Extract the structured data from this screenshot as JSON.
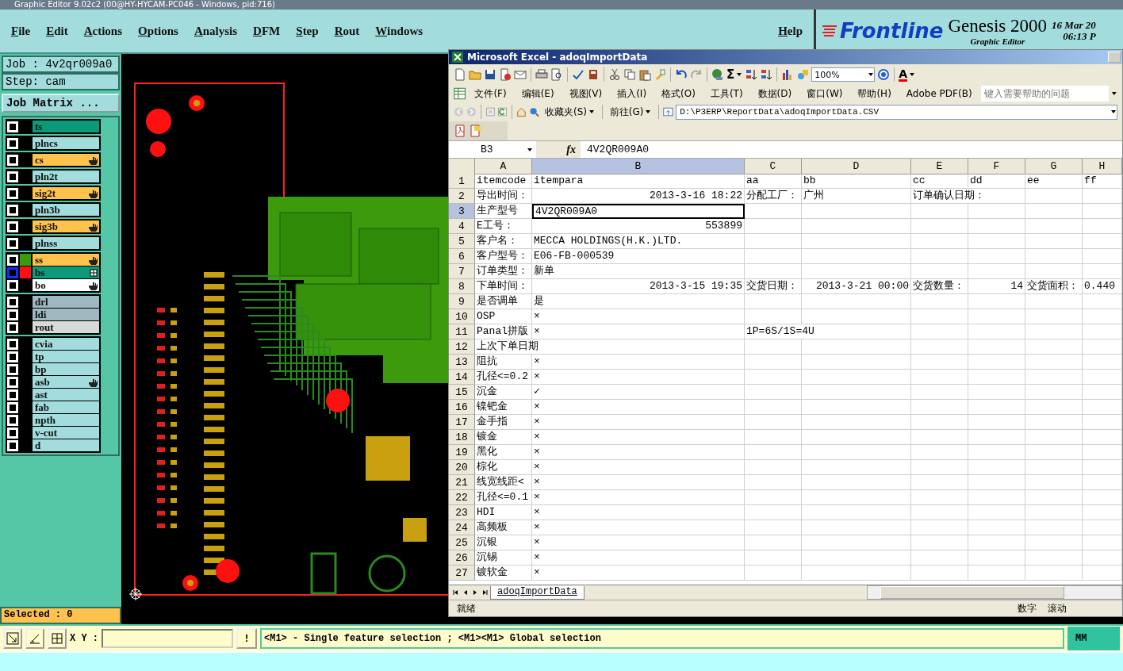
{
  "window": {
    "title": "Graphic Editor 9.02c2 (00@HY-HYCAM-PC046 - Windows, pid:716)"
  },
  "menu": [
    "File",
    "Edit",
    "Actions",
    "Options",
    "Analysis",
    "DFM",
    "Step",
    "Rout",
    "Windows"
  ],
  "help_menu": "Help",
  "brand": {
    "logo": "Frontline",
    "product": "Genesis 2000",
    "subtitle": "Graphic Editor",
    "date": "16 Mar 20",
    "time": "06:13 P"
  },
  "job": {
    "job": "Job : 4v2qr009a0",
    "step": "Step: cam",
    "matrix_button": "Job Matrix ..."
  },
  "layer_groups": [
    {
      "layers": [
        {
          "name": "ts",
          "color": "#0b9b7b",
          "checked": false,
          "affected": false,
          "work": false
        }
      ]
    },
    {
      "layers": [
        {
          "name": "plncs",
          "color": "#a3dcdc",
          "checked": false,
          "affected": false,
          "work": false
        }
      ]
    },
    {
      "layers": [
        {
          "name": "cs",
          "color": "#ffc34d",
          "checked": false,
          "affected": true,
          "work": false
        }
      ]
    },
    {
      "layers": [
        {
          "name": "pln2t",
          "color": "#a3dcdc",
          "checked": false,
          "affected": false,
          "work": false
        }
      ]
    },
    {
      "layers": [
        {
          "name": "sig2t",
          "color": "#ffc34d",
          "checked": false,
          "affected": true,
          "work": false
        }
      ]
    },
    {
      "layers": [
        {
          "name": "pln3b",
          "color": "#a3dcdc",
          "checked": false,
          "affected": false,
          "work": false
        }
      ]
    },
    {
      "layers": [
        {
          "name": "sig3b",
          "color": "#ffc34d",
          "checked": false,
          "affected": true,
          "work": false
        }
      ]
    },
    {
      "layers": [
        {
          "name": "plnss",
          "color": "#a3dcdc",
          "checked": false,
          "affected": false,
          "work": false
        }
      ]
    },
    {
      "layers": [
        {
          "name": "ss",
          "color": "#ffc34d",
          "swatch": {
            "color": "#3c9a0c"
          },
          "checked": false,
          "affected": true,
          "work": false
        },
        {
          "name": "bs",
          "color": "#0b9b7b",
          "swatch": {
            "color": "#ff1010"
          },
          "checked": false,
          "affected": false,
          "work": true
        },
        {
          "name": "bo",
          "color": "#ffffff",
          "checked": false,
          "affected": true,
          "work": false
        }
      ]
    },
    {
      "layers": [
        {
          "name": "drl",
          "color": "#9fb8bf",
          "checked": false,
          "affected": false,
          "work": false
        },
        {
          "name": "ldi",
          "color": "#9fb8bf",
          "checked": false,
          "affected": false,
          "work": false
        },
        {
          "name": "rout",
          "color": "#d9d9d9",
          "checked": false,
          "affected": false,
          "work": false
        }
      ]
    },
    {
      "layers": [
        {
          "name": "cvia",
          "color": "#a3dcdc",
          "checked": false,
          "affected": false,
          "work": false
        },
        {
          "name": "tp",
          "color": "#a3dcdc",
          "checked": false,
          "affected": false,
          "work": false
        },
        {
          "name": "bp",
          "color": "#a3dcdc",
          "checked": false,
          "affected": false,
          "work": false
        },
        {
          "name": "asb",
          "color": "#a3dcdc",
          "checked": false,
          "affected": true,
          "work": false
        },
        {
          "name": "ast",
          "color": "#a3dcdc",
          "checked": false,
          "affected": false,
          "work": false
        },
        {
          "name": "fab",
          "color": "#a3dcdc",
          "checked": false,
          "affected": false,
          "work": false
        },
        {
          "name": "npth",
          "color": "#a3dcdc",
          "checked": false,
          "affected": false,
          "work": false
        },
        {
          "name": "v-cut",
          "color": "#a3dcdc",
          "checked": false,
          "affected": false,
          "work": false
        },
        {
          "name": "d",
          "color": "#a3dcdc",
          "checked": false,
          "affected": false,
          "work": false
        }
      ]
    }
  ],
  "selected_count": "Selected : 0",
  "coord_label": "X Y :",
  "alert_button": "!",
  "message": "<M1> - Single feature selection ; <M1><M1> Global selection",
  "units": "MM",
  "excel": {
    "title": "Microsoft Excel - adoqImportData",
    "zoom": "100%",
    "autosum": "Σ",
    "font_color": "A",
    "menus": [
      "文件(F)",
      "编辑(E)",
      "视图(V)",
      "插入(I)",
      "格式(O)",
      "工具(T)",
      "数据(D)",
      "窗口(W)",
      "帮助(H)",
      "Adobe PDF(B)"
    ],
    "help_placeholder": "键入需要帮助的问题",
    "favorites": "收藏夹(S)",
    "go": "前往(G)",
    "address": "D:\\P3ERP\\ReportData\\adoqImportData.CSV",
    "name_box": "B3",
    "fx": "fx",
    "formula": "4V2QR009A0",
    "columns": [
      {
        "label": "A",
        "selected": false
      },
      {
        "label": "B",
        "selected": true
      },
      {
        "label": "C",
        "selected": false
      },
      {
        "label": "D",
        "selected": false
      },
      {
        "label": "E",
        "selected": false
      },
      {
        "label": "F",
        "selected": false
      },
      {
        "label": "G",
        "selected": false
      },
      {
        "label": "H",
        "selected": false
      }
    ],
    "rows": [
      {
        "number": "1",
        "selected": false,
        "cells": [
          {
            "kind": "text",
            "text": "itemcode"
          },
          {
            "kind": "text",
            "text": "itempara"
          },
          {
            "kind": "text",
            "text": "aa"
          },
          {
            "kind": "text",
            "text": "bb"
          },
          {
            "kind": "text",
            "text": "cc"
          },
          {
            "kind": "text",
            "text": "dd"
          },
          {
            "kind": "text",
            "text": "ee"
          },
          {
            "kind": "text",
            "text": "ff"
          }
        ]
      },
      {
        "number": "2",
        "selected": false,
        "cells": [
          {
            "kind": "text",
            "text": "导出时间："
          },
          {
            "kind": "number",
            "text": "2013-3-16 18:22"
          },
          {
            "kind": "text",
            "text": "分配工厂："
          },
          {
            "kind": "text",
            "text": "广州"
          },
          {
            "kind": "text",
            "text": "订单确认日期："
          }
        ]
      },
      {
        "number": "3",
        "selected": true,
        "cells": [
          {
            "kind": "text",
            "text": "生产型号"
          },
          {
            "kind": "text",
            "text": "4V2QR009A0"
          }
        ]
      },
      {
        "number": "4",
        "selected": false,
        "cells": [
          {
            "kind": "text",
            "text": "E工号："
          },
          {
            "kind": "number",
            "text": "553899"
          }
        ]
      },
      {
        "number": "5",
        "selected": false,
        "cells": [
          {
            "kind": "text",
            "text": "客户名："
          },
          {
            "kind": "text",
            "text": "MECCA HOLDINGS(H.K.)LTD."
          }
        ]
      },
      {
        "number": "6",
        "selected": false,
        "cells": [
          {
            "kind": "text",
            "text": "客户型号："
          },
          {
            "kind": "text",
            "text": "E06-FB-000539"
          }
        ]
      },
      {
        "number": "7",
        "selected": false,
        "cells": [
          {
            "kind": "text",
            "text": "订单类型："
          },
          {
            "kind": "text",
            "text": "新单"
          }
        ]
      },
      {
        "number": "8",
        "selected": false,
        "cells": [
          {
            "kind": "text",
            "text": "下单时间："
          },
          {
            "kind": "number",
            "text": "2013-3-15 19:35"
          },
          {
            "kind": "text",
            "text": "交货日期："
          },
          {
            "kind": "number",
            "text": "2013-3-21 00:00"
          },
          {
            "kind": "text",
            "text": "交货数量："
          },
          {
            "kind": "number",
            "text": "14"
          },
          {
            "kind": "text",
            "text": "交货面积："
          },
          {
            "kind": "text",
            "text": "0.440"
          }
        ]
      },
      {
        "number": "9",
        "selected": false,
        "cells": [
          {
            "kind": "text",
            "text": "是否调单"
          },
          {
            "kind": "text",
            "text": "是"
          }
        ]
      },
      {
        "number": "10",
        "selected": false,
        "cells": [
          {
            "kind": "text",
            "text": "OSP"
          },
          {
            "kind": "text",
            "text": "×"
          }
        ]
      },
      {
        "number": "11",
        "selected": false,
        "cells": [
          {
            "kind": "text",
            "text": "Panal拼版"
          },
          {
            "kind": "text",
            "text": "×"
          },
          {
            "kind": "text",
            "text": "1P=6S/1S=4U"
          }
        ]
      },
      {
        "number": "12",
        "selected": false,
        "cells": [
          {
            "kind": "text",
            "text": "上次下单日期"
          }
        ]
      },
      {
        "number": "13",
        "selected": false,
        "cells": [
          {
            "kind": "text",
            "text": "阻抗"
          },
          {
            "kind": "text",
            "text": "×"
          }
        ]
      },
      {
        "number": "14",
        "selected": false,
        "cells": [
          {
            "kind": "text",
            "text": "孔径<=0.2"
          },
          {
            "kind": "text",
            "text": "×"
          }
        ]
      },
      {
        "number": "15",
        "selected": false,
        "cells": [
          {
            "kind": "text",
            "text": "沉金"
          },
          {
            "kind": "text",
            "text": "✓"
          }
        ]
      },
      {
        "number": "16",
        "selected": false,
        "cells": [
          {
            "kind": "text",
            "text": "镍钯金"
          },
          {
            "kind": "text",
            "text": "×"
          }
        ]
      },
      {
        "number": "17",
        "selected": false,
        "cells": [
          {
            "kind": "text",
            "text": "金手指"
          },
          {
            "kind": "text",
            "text": "×"
          }
        ]
      },
      {
        "number": "18",
        "selected": false,
        "cells": [
          {
            "kind": "text",
            "text": "镀金"
          },
          {
            "kind": "text",
            "text": "×"
          }
        ]
      },
      {
        "number": "19",
        "selected": false,
        "cells": [
          {
            "kind": "text",
            "text": "黑化"
          },
          {
            "kind": "text",
            "text": "×"
          }
        ]
      },
      {
        "number": "20",
        "selected": false,
        "cells": [
          {
            "kind": "text",
            "text": "棕化"
          },
          {
            "kind": "text",
            "text": "×"
          }
        ]
      },
      {
        "number": "21",
        "selected": false,
        "cells": [
          {
            "kind": "text",
            "text": "线宽线距<"
          },
          {
            "kind": "text",
            "text": "×"
          }
        ]
      },
      {
        "number": "22",
        "selected": false,
        "cells": [
          {
            "kind": "text",
            "text": "孔径<=0.1"
          },
          {
            "kind": "text",
            "text": "×"
          }
        ]
      },
      {
        "number": "23",
        "selected": false,
        "cells": [
          {
            "kind": "text",
            "text": "HDI"
          },
          {
            "kind": "text",
            "text": "×"
          }
        ]
      },
      {
        "number": "24",
        "selected": false,
        "cells": [
          {
            "kind": "text",
            "text": "高频板"
          },
          {
            "kind": "text",
            "text": "×"
          }
        ]
      },
      {
        "number": "25",
        "selected": false,
        "cells": [
          {
            "kind": "text",
            "text": "沉银"
          },
          {
            "kind": "text",
            "text": "×"
          }
        ]
      },
      {
        "number": "26",
        "selected": false,
        "cells": [
          {
            "kind": "text",
            "text": "沉锡"
          },
          {
            "kind": "text",
            "text": "×"
          }
        ]
      },
      {
        "number": "27",
        "selected": false,
        "cells": [
          {
            "kind": "text",
            "text": "镀软金"
          },
          {
            "kind": "text",
            "text": "×"
          }
        ]
      }
    ],
    "sheet_tab": {
      "label": "adoqImportData",
      "selected": true
    },
    "status": "就绪",
    "indicators": [
      "数字",
      "滚动"
    ]
  }
}
